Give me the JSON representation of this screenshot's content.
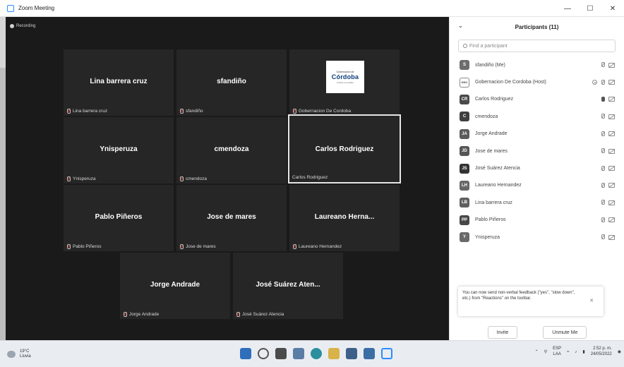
{
  "window": {
    "title": "Zoom Meeting"
  },
  "meeting": {
    "recording_label": "Recording",
    "tiles": [
      {
        "display": "Lina barrera cruz",
        "label": "Lina barrera cruz"
      },
      {
        "display": "sfandiño",
        "label": "sfandiño"
      },
      {
        "label": "Gobernacion De Cordoba",
        "logo_top": "Gobernación de",
        "logo_main": "Córdoba",
        "logo_bottom": "Unidos es posible"
      },
      {
        "display": "Ynisperuza",
        "label": "Ynisperuza"
      },
      {
        "display": "cmendoza",
        "label": "cmendoza"
      },
      {
        "display": "Carlos Rodriguez",
        "label": "Carlos Rodriguez"
      },
      {
        "display": "Pablo Piñeros",
        "label": "Pablo Piñeros"
      },
      {
        "display": "Jose de mares",
        "label": "Jose de mares"
      },
      {
        "display": "Laureano Herna...",
        "label": "Laureano Hernandez"
      },
      {
        "display": "Jorge Andrade",
        "label": "Jorge Andrade"
      },
      {
        "display": "José Suárez Aten...",
        "label": "José Suárez Atencia"
      }
    ]
  },
  "participants": {
    "title": "Participants (11)",
    "search_placeholder": "Find a participant",
    "list": [
      {
        "initials": "S",
        "name": "sfandiño (Me)"
      },
      {
        "initials": "GDC",
        "name": "Gobernacion De Cordoba (Host)"
      },
      {
        "initials": "CR",
        "name": "Carlos Rodriguez"
      },
      {
        "initials": "C",
        "name": "cmendoza"
      },
      {
        "initials": "JA",
        "name": "Jorge Andrade"
      },
      {
        "initials": "JD",
        "name": "Jose de mares"
      },
      {
        "initials": "JS",
        "name": "José Suárez Atencia"
      },
      {
        "initials": "LH",
        "name": "Laureano Hernandez"
      },
      {
        "initials": "LB",
        "name": "Lina barrera cruz"
      },
      {
        "initials": "PP",
        "name": "Pablo Piñeros"
      },
      {
        "initials": "Y",
        "name": "Ynisperuza"
      }
    ],
    "tip": "You can now send non-verbal feedback (\"yes\", \"slow down\", etc.) from \"Reactions\" on the toolbar.",
    "invite_label": "Invite",
    "unmute_label": "Unmute Me"
  },
  "taskbar": {
    "weather": {
      "temp": "19°C",
      "condition": "Lluvia"
    },
    "lang": "ESP",
    "layout": "LAA",
    "time": "2:52 p. m.",
    "date": "24/05/2022"
  }
}
